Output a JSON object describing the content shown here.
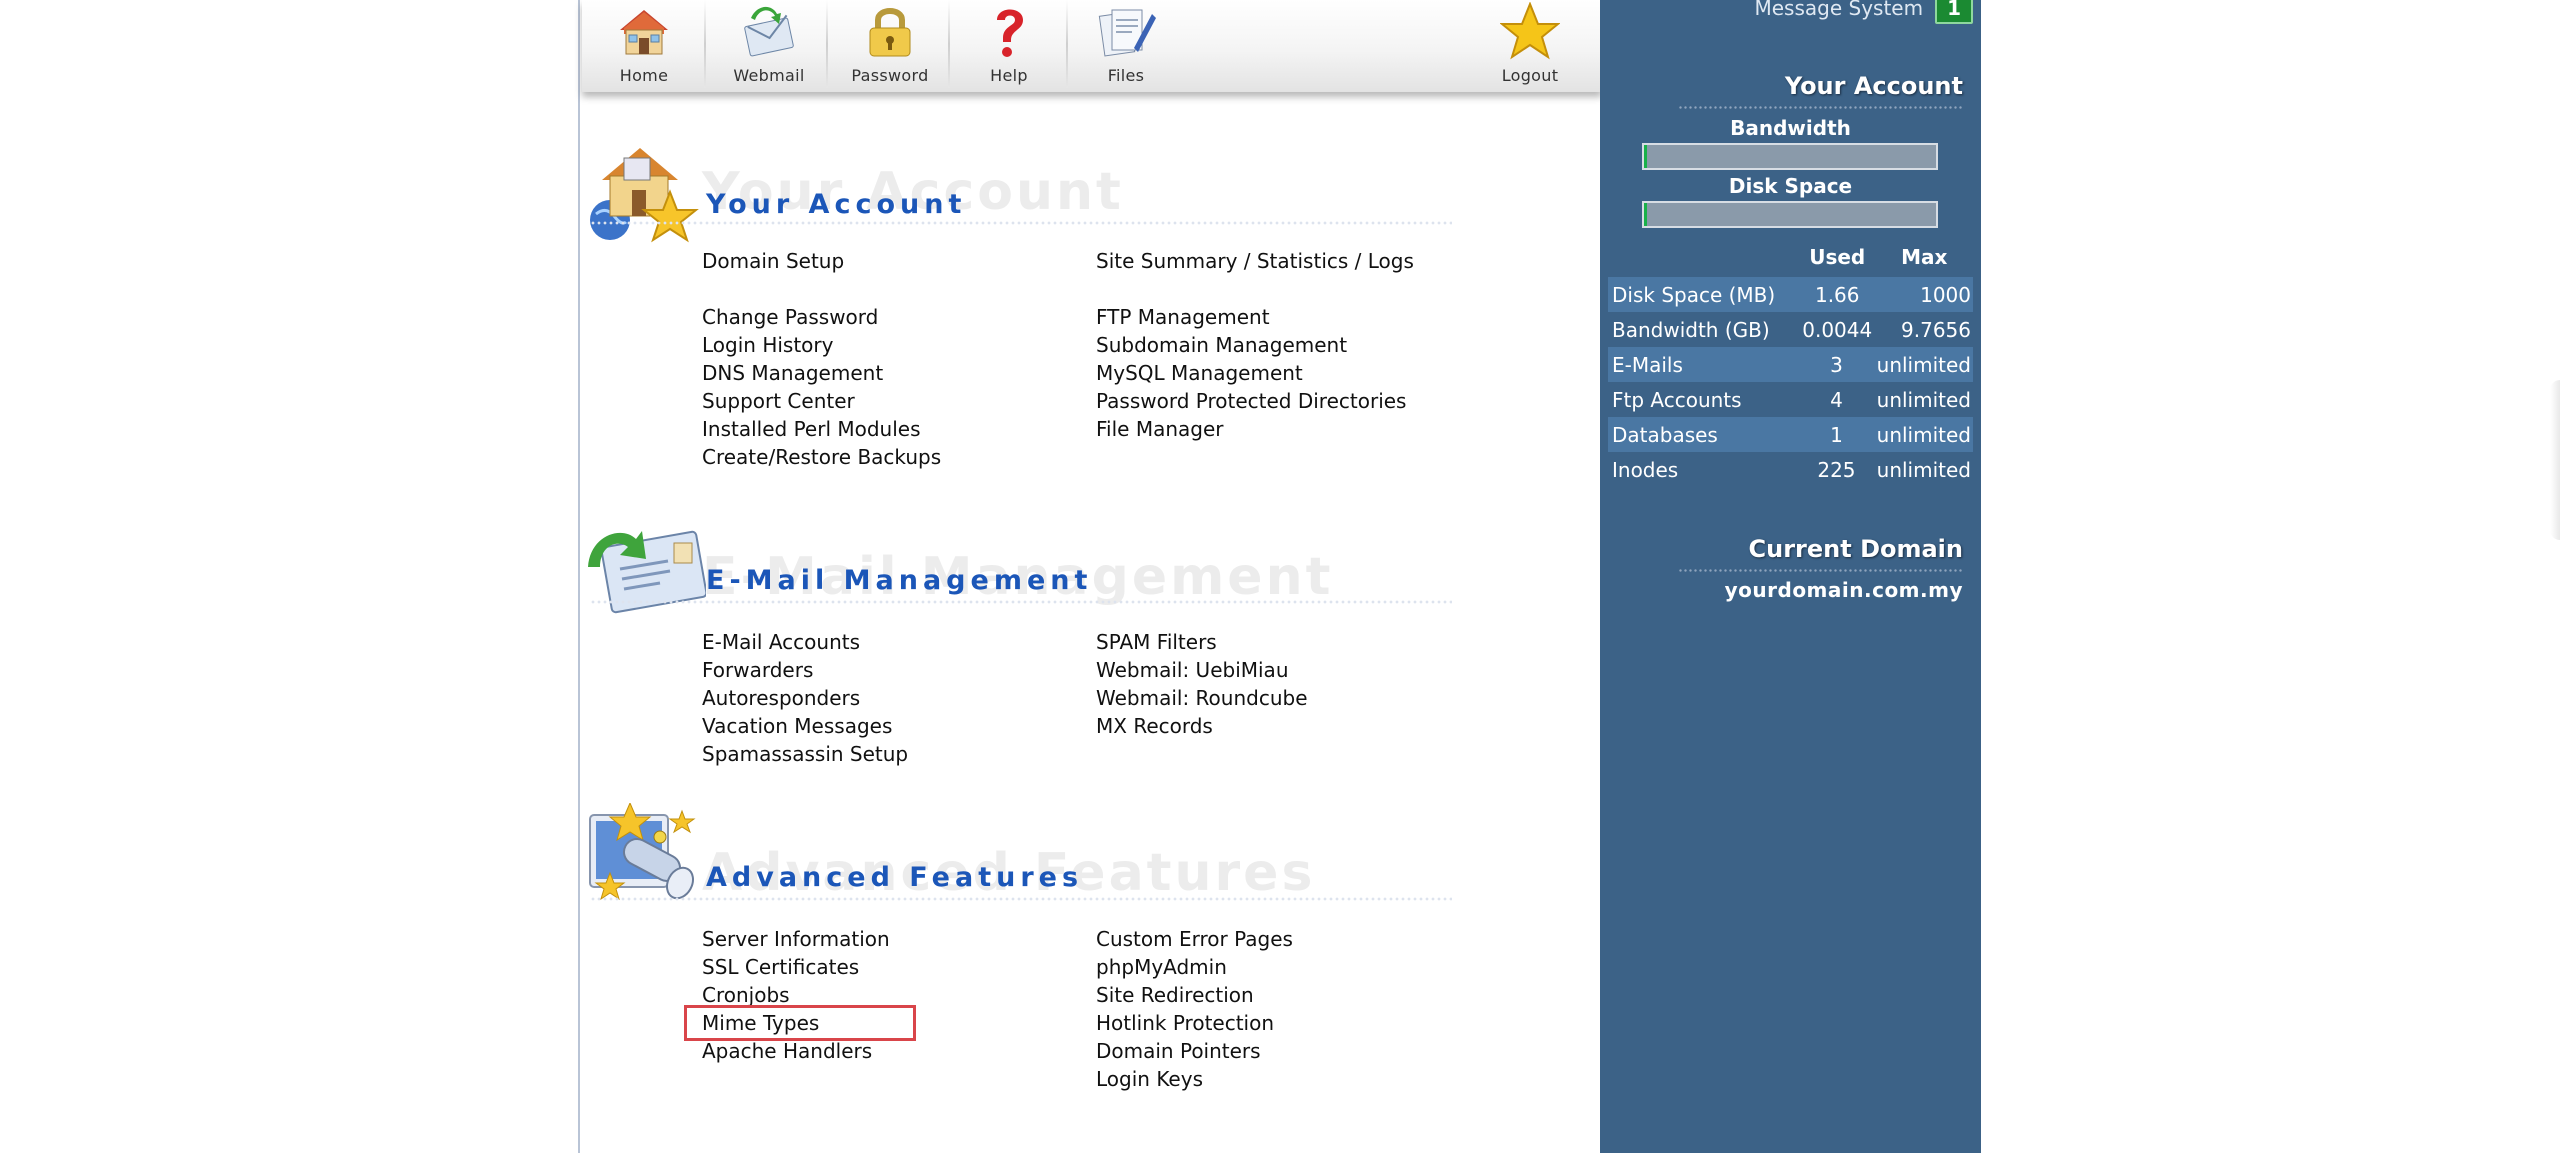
{
  "toolbar": {
    "items": [
      {
        "label": "Home",
        "icon": "home-icon"
      },
      {
        "label": "Webmail",
        "icon": "webmail-icon"
      },
      {
        "label": "Password",
        "icon": "lock-icon"
      },
      {
        "label": "Help",
        "icon": "question-icon"
      },
      {
        "label": "Files",
        "icon": "files-icon"
      },
      {
        "label": "Logout",
        "icon": "star-icon"
      }
    ]
  },
  "sections": {
    "account": {
      "title": "Your Account",
      "ghost": "Your Account",
      "icon": "house-star-globe-icon",
      "left": [
        "Domain Setup",
        "Change Password",
        "Login History",
        "DNS Management",
        "Support Center",
        "Installed Perl Modules",
        "Create/Restore Backups"
      ],
      "right": [
        "Site Summary / Statistics / Logs",
        "FTP Management",
        "Subdomain Management",
        "MySQL Management",
        "Password Protected Directories",
        "File Manager"
      ]
    },
    "email": {
      "title": "E-Mail Management",
      "ghost": "E-Mail Management",
      "icon": "envelope-arrow-icon",
      "left": [
        "E-Mail Accounts",
        "Forwarders",
        "Autoresponders",
        "Vacation Messages",
        "Spamassassin Setup"
      ],
      "right": [
        "SPAM Filters",
        "Webmail: UebiMiau",
        "Webmail: Roundcube",
        "MX Records"
      ]
    },
    "advanced": {
      "title": "Advanced Features",
      "ghost": "Advanced Features",
      "icon": "telescope-stars-icon",
      "left": [
        "Server Information",
        "SSL Certificates",
        "Cronjobs",
        "Mime Types",
        "Apache Handlers"
      ],
      "right": [
        "Custom Error Pages",
        "phpMyAdmin",
        "Site Redirection",
        "Hotlink Protection",
        "Domain Pointers",
        "Login Keys"
      ]
    }
  },
  "side": {
    "message_label": "Message System",
    "message_count": "1",
    "account_title": "Your Account",
    "bandwidth_label": "Bandwidth",
    "bandwidth_fraction": 0.0005,
    "disk_label": "Disk Space",
    "disk_fraction": 0.0017,
    "usage": {
      "headers": [
        "",
        "Used",
        "Max"
      ],
      "rows": [
        {
          "name": "Disk Space (MB)",
          "used": "1.66",
          "max": "1000"
        },
        {
          "name": "Bandwidth (GB)",
          "used": "0.0044",
          "max": "9.7656"
        },
        {
          "name": "E-Mails",
          "used": "3",
          "max": "unlimited"
        },
        {
          "name": "Ftp Accounts",
          "used": "4",
          "max": "unlimited"
        },
        {
          "name": "Databases",
          "used": "1",
          "max": "unlimited"
        },
        {
          "name": "Inodes",
          "used": "225",
          "max": "unlimited"
        }
      ]
    },
    "domain_title": "Current Domain",
    "domain_value": "yourdomain.com.my"
  },
  "colors": {
    "sidebar_bg": "#3c6287",
    "title_blue": "#1b56b8",
    "highlight": "#d9454a",
    "meter_fill": "#19b14a"
  }
}
